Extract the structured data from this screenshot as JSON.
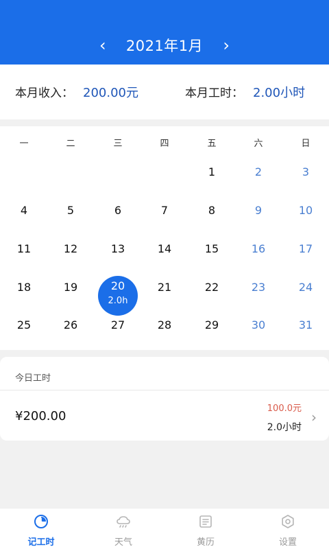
{
  "header": {
    "month": "2021年1月",
    "prev_icon": "chevron-left-icon",
    "next_icon": "chevron-right-icon"
  },
  "summary": {
    "income_label": "本月收入：",
    "income_value": "200.00元",
    "hours_label": "本月工时：",
    "hours_value": "2.00小时"
  },
  "calendar": {
    "weekdays": [
      "一",
      "二",
      "三",
      "四",
      "五",
      "六",
      "日"
    ],
    "weeks": [
      [
        "",
        "",
        "",
        "",
        "1",
        "2",
        "3"
      ],
      [
        "4",
        "5",
        "6",
        "7",
        "8",
        "9",
        "10"
      ],
      [
        "11",
        "12",
        "13",
        "14",
        "15",
        "16",
        "17"
      ],
      [
        "18",
        "19",
        "20",
        "21",
        "22",
        "23",
        "24"
      ],
      [
        "25",
        "26",
        "27",
        "28",
        "29",
        "30",
        "31"
      ]
    ],
    "selected_day": "20",
    "selected_hours": "2.0h",
    "weekend_color": "#4a7fd1",
    "accent_color": "#1b6ee8"
  },
  "today": {
    "title": "今日工时",
    "amount": "¥200.00",
    "earn": "100.0元",
    "hours": "2.0小时",
    "earn_color": "#d95a4a"
  },
  "tabbar": {
    "tabs": [
      {
        "label": "记工时",
        "icon": "clock-icon",
        "active": true
      },
      {
        "label": "天气",
        "icon": "weather-icon",
        "active": false
      },
      {
        "label": "黄历",
        "icon": "almanac-icon",
        "active": false
      },
      {
        "label": "设置",
        "icon": "settings-icon",
        "active": false
      }
    ]
  }
}
